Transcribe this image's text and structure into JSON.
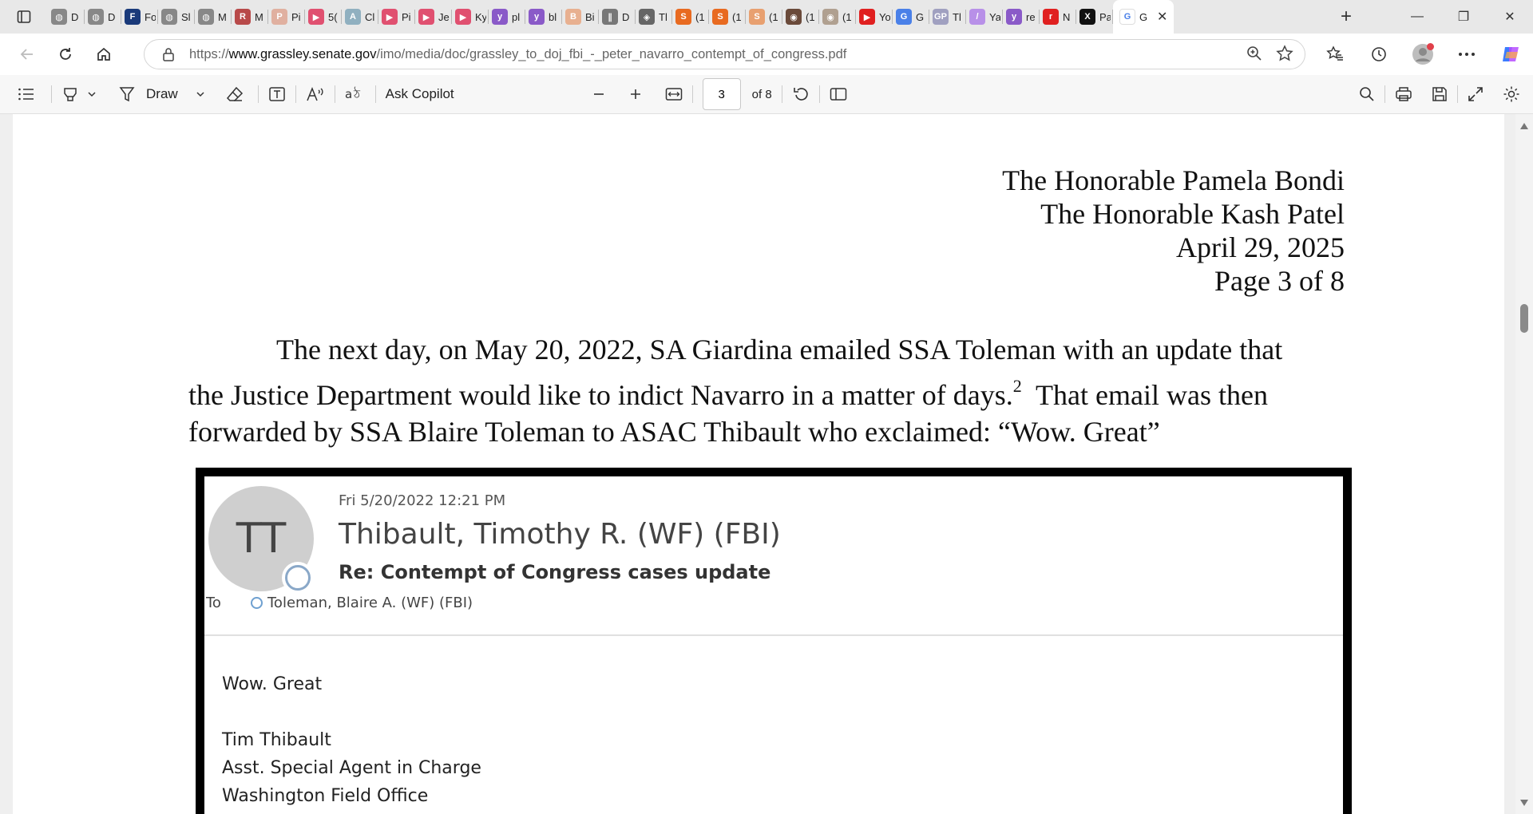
{
  "browser": {
    "tabs": [
      {
        "label": "D",
        "color": "#888888",
        "glyph": "◍"
      },
      {
        "label": "D",
        "color": "#888888",
        "glyph": "◍"
      },
      {
        "label": "Fo",
        "color": "#1a3a7a",
        "glyph": "F"
      },
      {
        "label": "Sl",
        "color": "#888888",
        "glyph": "◍"
      },
      {
        "label": "M",
        "color": "#888888",
        "glyph": "◍"
      },
      {
        "label": "M",
        "color": "#b84a4a",
        "glyph": "R"
      },
      {
        "label": "Pi",
        "color": "#e0b0a0",
        "glyph": "P"
      },
      {
        "label": "5(",
        "color": "#e05070",
        "glyph": "▶"
      },
      {
        "label": "Cl",
        "color": "#90b0c0",
        "glyph": "A"
      },
      {
        "label": "Pi",
        "color": "#e05070",
        "glyph": "▶"
      },
      {
        "label": "Je",
        "color": "#e05070",
        "glyph": "▶"
      },
      {
        "label": "Ky",
        "color": "#e05070",
        "glyph": "▶"
      },
      {
        "label": "pl",
        "color": "#8a5ac8",
        "glyph": "y"
      },
      {
        "label": "bl",
        "color": "#8a5ac8",
        "glyph": "y"
      },
      {
        "label": "Bi",
        "color": "#e8b090",
        "glyph": "B"
      },
      {
        "label": "D",
        "color": "#777777",
        "glyph": "∥"
      },
      {
        "label": "Tl",
        "color": "#666666",
        "glyph": "◈"
      },
      {
        "label": "(1",
        "color": "#e86a20",
        "glyph": "S"
      },
      {
        "label": "(1",
        "color": "#e86a20",
        "glyph": "S"
      },
      {
        "label": "(1",
        "color": "#e8a070",
        "glyph": "S"
      },
      {
        "label": "(1",
        "color": "#6a4a3a",
        "glyph": "◉"
      },
      {
        "label": "(1",
        "color": "#b0a090",
        "glyph": "◉"
      },
      {
        "label": "Yo",
        "color": "#e02020",
        "glyph": "▶"
      },
      {
        "label": "G",
        "color": "#4a80e8",
        "glyph": "G"
      },
      {
        "label": "Tl",
        "color": "#a0a0c0",
        "glyph": "GP"
      },
      {
        "label": "Ya",
        "color": "#b890e8",
        "glyph": "/"
      },
      {
        "label": "re",
        "color": "#8a5ac8",
        "glyph": "y"
      },
      {
        "label": "N",
        "color": "#e02020",
        "glyph": "r"
      },
      {
        "label": "Pa",
        "color": "#111111",
        "glyph": "X"
      }
    ],
    "active_tab": {
      "label": "G",
      "close": "✕"
    },
    "new_tab_glyph": "+",
    "window": {
      "minimize": "—",
      "restore": "❐",
      "close": "✕"
    },
    "url_scheme": "https://",
    "url_host": "www.grassley.senate.gov",
    "url_path": "/imo/media/doc/grassley_to_doj_fbi_-_peter_navarro_contempt_of_congress.pdf",
    "profile_badge_color": "#e0404a"
  },
  "pdf_toolbar": {
    "draw_label": "Draw",
    "ask_copilot_label": "Ask Copilot",
    "page_current": "3",
    "page_total": "of 8"
  },
  "document": {
    "header_lines": [
      "The Honorable Pamela Bondi",
      "The Honorable Kash Patel",
      "April 29, 2025",
      "Page 3 of 8"
    ],
    "para_line1": "The next day, on May 20, 2022, SA Giardina emailed SSA Toleman with an update that",
    "para_line2a": "the Justice Department would like to indict Navarro in a matter of days.",
    "para_footnote": "2",
    "para_line2b": "  That email was then",
    "para_line3": "forwarded by SSA Blaire Toleman to ASAC Thibault who exclaimed: “Wow. Great”"
  },
  "email": {
    "avatar_initials": "TT",
    "date": "Fri 5/20/2022 12:21 PM",
    "from": "Thibault, Timothy R. (WF) (FBI)",
    "subject": "Re: Contempt of Congress cases update",
    "to_label": "To",
    "to": "Toleman, Blaire A. (WF) (FBI)",
    "body_line1": "Wow.  Great",
    "sig_name": "Tim Thibault",
    "sig_title": "Asst. Special Agent in Charge",
    "sig_office": "Washington Field Office"
  }
}
